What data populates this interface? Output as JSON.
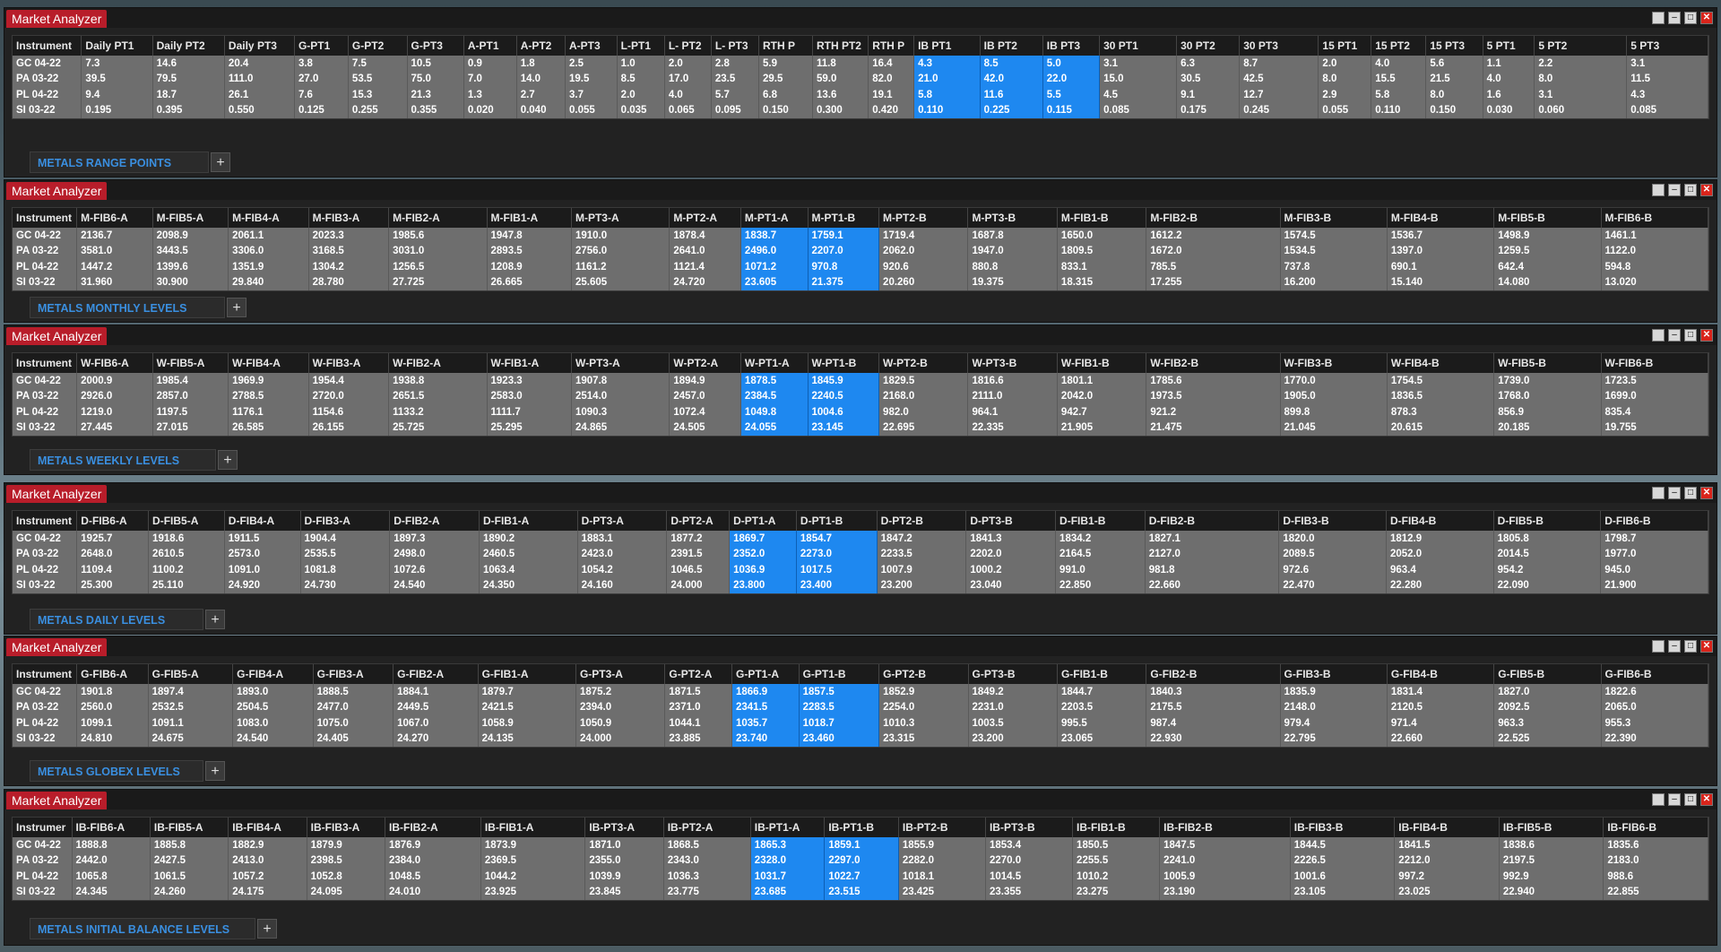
{
  "windows": [
    {
      "title": "Market Analyzer",
      "tab_label": "METALS RANGE POINTS",
      "headers": [
        "Instrument",
        "Daily PT1",
        "Daily PT2",
        "Daily PT3",
        "G-PT1",
        "G-PT2",
        "G-PT3",
        "A-PT1",
        "A-PT2",
        "A-PT3",
        "L-PT1",
        "L- PT2",
        "L- PT3",
        "RTH P",
        "RTH PT2",
        "RTH P",
        "IB PT1",
        "IB PT2",
        "IB PT3",
        "30 PT1",
        "30 PT2",
        "30 PT3",
        "15 PT1",
        "15 PT2",
        "15 PT3",
        "5 PT1",
        "5 PT2",
        "5 PT3"
      ],
      "highlight_cols": [
        16,
        17,
        18
      ],
      "rows": [
        [
          "GC 04-22",
          "7.3",
          "14.6",
          "20.4",
          "3.8",
          "7.5",
          "10.5",
          "0.9",
          "1.8",
          "2.5",
          "1.0",
          "2.0",
          "2.8",
          "5.9",
          "11.8",
          "16.4",
          "4.3",
          "8.5",
          "5.0",
          "3.1",
          "6.3",
          "8.7",
          "2.0",
          "4.0",
          "5.6",
          "1.1",
          "2.2",
          "3.1"
        ],
        [
          "PA 03-22",
          "39.5",
          "79.5",
          "111.0",
          "27.0",
          "53.5",
          "75.0",
          "7.0",
          "14.0",
          "19.5",
          "8.5",
          "17.0",
          "23.5",
          "29.5",
          "59.0",
          "82.0",
          "21.0",
          "42.0",
          "22.0",
          "15.0",
          "30.5",
          "42.5",
          "8.0",
          "15.5",
          "21.5",
          "4.0",
          "8.0",
          "11.5"
        ],
        [
          "PL 04-22",
          "9.4",
          "18.7",
          "26.1",
          "7.6",
          "15.3",
          "21.3",
          "1.3",
          "2.7",
          "3.7",
          "2.0",
          "4.0",
          "5.7",
          "6.8",
          "13.6",
          "19.1",
          "5.8",
          "11.6",
          "5.5",
          "4.5",
          "9.1",
          "12.7",
          "2.9",
          "5.8",
          "8.0",
          "1.6",
          "3.1",
          "4.3"
        ],
        [
          "SI 03-22",
          "0.195",
          "0.395",
          "0.550",
          "0.125",
          "0.255",
          "0.355",
          "0.020",
          "0.040",
          "0.055",
          "0.035",
          "0.065",
          "0.095",
          "0.150",
          "0.300",
          "0.420",
          "0.110",
          "0.225",
          "0.115",
          "0.085",
          "0.175",
          "0.245",
          "0.055",
          "0.110",
          "0.150",
          "0.030",
          "0.060",
          "0.085"
        ]
      ]
    },
    {
      "title": "Market Analyzer",
      "tab_label": "METALS MONTHLY LEVELS",
      "headers": [
        "Instrument",
        "M-FIB6-A",
        "M-FIB5-A",
        "M-FIB4-A",
        "M-FIB3-A",
        "M-FIB2-A",
        "M-FIB1-A",
        "M-PT3-A",
        "M-PT2-A",
        "M-PT1-A",
        "M-PT1-B",
        "M-PT2-B",
        "M-PT3-B",
        "M-FIB1-B",
        "M-FIB2-B",
        "M-FIB3-B",
        "M-FIB4-B",
        "M-FIB5-B",
        "M-FIB6-B"
      ],
      "highlight_cols": [
        9,
        10
      ],
      "rows": [
        [
          "GC 04-22",
          "2136.7",
          "2098.9",
          "2061.1",
          "2023.3",
          "1985.6",
          "1947.8",
          "1910.0",
          "1878.4",
          "1838.7",
          "1759.1",
          "1719.4",
          "1687.8",
          "1650.0",
          "1612.2",
          "1574.5",
          "1536.7",
          "1498.9",
          "1461.1"
        ],
        [
          "PA 03-22",
          "3581.0",
          "3443.5",
          "3306.0",
          "3168.5",
          "3031.0",
          "2893.5",
          "2756.0",
          "2641.0",
          "2496.0",
          "2207.0",
          "2062.0",
          "1947.0",
          "1809.5",
          "1672.0",
          "1534.5",
          "1397.0",
          "1259.5",
          "1122.0"
        ],
        [
          "PL 04-22",
          "1447.2",
          "1399.6",
          "1351.9",
          "1304.2",
          "1256.5",
          "1208.9",
          "1161.2",
          "1121.4",
          "1071.2",
          "970.8",
          "920.6",
          "880.8",
          "833.1",
          "785.5",
          "737.8",
          "690.1",
          "642.4",
          "594.8"
        ],
        [
          "SI 03-22",
          "31.960",
          "30.900",
          "29.840",
          "28.780",
          "27.725",
          "26.665",
          "25.605",
          "24.720",
          "23.605",
          "21.375",
          "20.260",
          "19.375",
          "18.315",
          "17.255",
          "16.200",
          "15.140",
          "14.080",
          "13.020"
        ]
      ]
    },
    {
      "title": "Market Analyzer",
      "tab_label": "METALS WEEKLY LEVELS",
      "headers": [
        "Instrument",
        "W-FIB6-A",
        "W-FIB5-A",
        "W-FIB4-A",
        "W-FIB3-A",
        "W-FIB2-A",
        "W-FIB1-A",
        "W-PT3-A",
        "W-PT2-A",
        "W-PT1-A",
        "W-PT1-B",
        "W-PT2-B",
        "W-PT3-B",
        "W-FIB1-B",
        "W-FIB2-B",
        "W-FIB3-B",
        "W-FIB4-B",
        "W-FIB5-B",
        "W-FIB6-B"
      ],
      "highlight_cols": [
        9,
        10
      ],
      "rows": [
        [
          "GC 04-22",
          "2000.9",
          "1985.4",
          "1969.9",
          "1954.4",
          "1938.8",
          "1923.3",
          "1907.8",
          "1894.9",
          "1878.5",
          "1845.9",
          "1829.5",
          "1816.6",
          "1801.1",
          "1785.6",
          "1770.0",
          "1754.5",
          "1739.0",
          "1723.5"
        ],
        [
          "PA 03-22",
          "2926.0",
          "2857.0",
          "2788.5",
          "2720.0",
          "2651.5",
          "2583.0",
          "2514.0",
          "2457.0",
          "2384.5",
          "2240.5",
          "2168.0",
          "2111.0",
          "2042.0",
          "1973.5",
          "1905.0",
          "1836.5",
          "1768.0",
          "1699.0"
        ],
        [
          "PL 04-22",
          "1219.0",
          "1197.5",
          "1176.1",
          "1154.6",
          "1133.2",
          "1111.7",
          "1090.3",
          "1072.4",
          "1049.8",
          "1004.6",
          "982.0",
          "964.1",
          "942.7",
          "921.2",
          "899.8",
          "878.3",
          "856.9",
          "835.4"
        ],
        [
          "SI 03-22",
          "27.445",
          "27.015",
          "26.585",
          "26.155",
          "25.725",
          "25.295",
          "24.865",
          "24.505",
          "24.055",
          "23.145",
          "22.695",
          "22.335",
          "21.905",
          "21.475",
          "21.045",
          "20.615",
          "20.185",
          "19.755"
        ]
      ]
    },
    {
      "title": "Market Analyzer",
      "tab_label": "METALS DAILY LEVELS",
      "headers": [
        "Instrument",
        "D-FIB6-A",
        "D-FIB5-A",
        "D-FIB4-A",
        "D-FIB3-A",
        "D-FIB2-A",
        "D-FIB1-A",
        "D-PT3-A",
        "D-PT2-A",
        "D-PT1-A",
        "D-PT1-B",
        "D-PT2-B",
        "D-PT3-B",
        "D-FIB1-B",
        "D-FIB2-B",
        "D-FIB3-B",
        "D-FIB4-B",
        "D-FIB5-B",
        "D-FIB6-B"
      ],
      "highlight_cols": [
        9,
        10
      ],
      "rows": [
        [
          "GC 04-22",
          "1925.7",
          "1918.6",
          "1911.5",
          "1904.4",
          "1897.3",
          "1890.2",
          "1883.1",
          "1877.2",
          "1869.7",
          "1854.7",
          "1847.2",
          "1841.3",
          "1834.2",
          "1827.1",
          "1820.0",
          "1812.9",
          "1805.8",
          "1798.7"
        ],
        [
          "PA 03-22",
          "2648.0",
          "2610.5",
          "2573.0",
          "2535.5",
          "2498.0",
          "2460.5",
          "2423.0",
          "2391.5",
          "2352.0",
          "2273.0",
          "2233.5",
          "2202.0",
          "2164.5",
          "2127.0",
          "2089.5",
          "2052.0",
          "2014.5",
          "1977.0"
        ],
        [
          "PL 04-22",
          "1109.4",
          "1100.2",
          "1091.0",
          "1081.8",
          "1072.6",
          "1063.4",
          "1054.2",
          "1046.5",
          "1036.9",
          "1017.5",
          "1007.9",
          "1000.2",
          "991.0",
          "981.8",
          "972.6",
          "963.4",
          "954.2",
          "945.0"
        ],
        [
          "SI 03-22",
          "25.300",
          "25.110",
          "24.920",
          "24.730",
          "24.540",
          "24.350",
          "24.160",
          "24.000",
          "23.800",
          "23.400",
          "23.200",
          "23.040",
          "22.850",
          "22.660",
          "22.470",
          "22.280",
          "22.090",
          "21.900"
        ]
      ]
    },
    {
      "title": "Market Analyzer",
      "tab_label": "METALS GLOBEX LEVELS",
      "headers": [
        "Instrument",
        "G-FIB6-A",
        "G-FIB5-A",
        "G-FIB4-A",
        "G-FIB3-A",
        "G-FIB2-A",
        "G-FIB1-A",
        "G-PT3-A",
        "G-PT2-A",
        "G-PT1-A",
        "G-PT1-B",
        "G-PT2-B",
        "G-PT3-B",
        "G-FIB1-B",
        "G-FIB2-B",
        "G-FIB3-B",
        "G-FIB4-B",
        "G-FIB5-B",
        "G-FIB6-B"
      ],
      "highlight_cols": [
        9,
        10
      ],
      "rows": [
        [
          "GC 04-22",
          "1901.8",
          "1897.4",
          "1893.0",
          "1888.5",
          "1884.1",
          "1879.7",
          "1875.2",
          "1871.5",
          "1866.9",
          "1857.5",
          "1852.9",
          "1849.2",
          "1844.7",
          "1840.3",
          "1835.9",
          "1831.4",
          "1827.0",
          "1822.6"
        ],
        [
          "PA 03-22",
          "2560.0",
          "2532.5",
          "2504.5",
          "2477.0",
          "2449.5",
          "2421.5",
          "2394.0",
          "2371.0",
          "2341.5",
          "2283.5",
          "2254.0",
          "2231.0",
          "2203.5",
          "2175.5",
          "2148.0",
          "2120.5",
          "2092.5",
          "2065.0"
        ],
        [
          "PL 04-22",
          "1099.1",
          "1091.1",
          "1083.0",
          "1075.0",
          "1067.0",
          "1058.9",
          "1050.9",
          "1044.1",
          "1035.7",
          "1018.7",
          "1010.3",
          "1003.5",
          "995.5",
          "987.4",
          "979.4",
          "971.4",
          "963.3",
          "955.3"
        ],
        [
          "SI 03-22",
          "24.810",
          "24.675",
          "24.540",
          "24.405",
          "24.270",
          "24.135",
          "24.000",
          "23.885",
          "23.740",
          "23.460",
          "23.315",
          "23.200",
          "23.065",
          "22.930",
          "22.795",
          "22.660",
          "22.525",
          "22.390"
        ]
      ]
    },
    {
      "title": "Market Analyzer",
      "tab_label": "METALS  INITIAL BALANCE LEVELS",
      "headers": [
        "Instrumer",
        "IB-FIB6-A",
        "IB-FIB5-A",
        "IB-FIB4-A",
        "IB-FIB3-A",
        "IB-FIB2-A",
        "IB-FIB1-A",
        "IB-PT3-A",
        "IB-PT2-A",
        "IB-PT1-A",
        "IB-PT1-B",
        "IB-PT2-B",
        "IB-PT3-B",
        "IB-FIB1-B",
        "IB-FIB2-B",
        "IB-FIB3-B",
        "IB-FIB4-B",
        "IB-FIB5-B",
        "IB-FIB6-B"
      ],
      "highlight_cols": [
        9,
        10
      ],
      "rows": [
        [
          "GC 04-22",
          "1888.8",
          "1885.8",
          "1882.9",
          "1879.9",
          "1876.9",
          "1873.9",
          "1871.0",
          "1868.5",
          "1865.3",
          "1859.1",
          "1855.9",
          "1853.4",
          "1850.5",
          "1847.5",
          "1844.5",
          "1841.5",
          "1838.6",
          "1835.6"
        ],
        [
          "PA 03-22",
          "2442.0",
          "2427.5",
          "2413.0",
          "2398.5",
          "2384.0",
          "2369.5",
          "2355.0",
          "2343.0",
          "2328.0",
          "2297.0",
          "2282.0",
          "2270.0",
          "2255.5",
          "2241.0",
          "2226.5",
          "2212.0",
          "2197.5",
          "2183.0"
        ],
        [
          "PL 04-22",
          "1065.8",
          "1061.5",
          "1057.2",
          "1052.8",
          "1048.5",
          "1044.2",
          "1039.9",
          "1036.3",
          "1031.7",
          "1022.7",
          "1018.1",
          "1014.5",
          "1010.2",
          "1005.9",
          "1001.6",
          "997.2",
          "992.9",
          "988.6"
        ],
        [
          "SI 03-22",
          "24.345",
          "24.260",
          "24.175",
          "24.095",
          "24.010",
          "23.925",
          "23.845",
          "23.775",
          "23.685",
          "23.515",
          "23.425",
          "23.355",
          "23.275",
          "23.190",
          "23.105",
          "23.025",
          "22.940",
          "22.855"
        ]
      ]
    }
  ],
  "colors": {
    "title_tab": "#b81d2a",
    "highlight": "#1e88f0",
    "tab_text": "#3a8fe0"
  },
  "window_buttons": [
    "minimize-icon",
    "restore-icon",
    "maximize-icon",
    "close-icon"
  ]
}
